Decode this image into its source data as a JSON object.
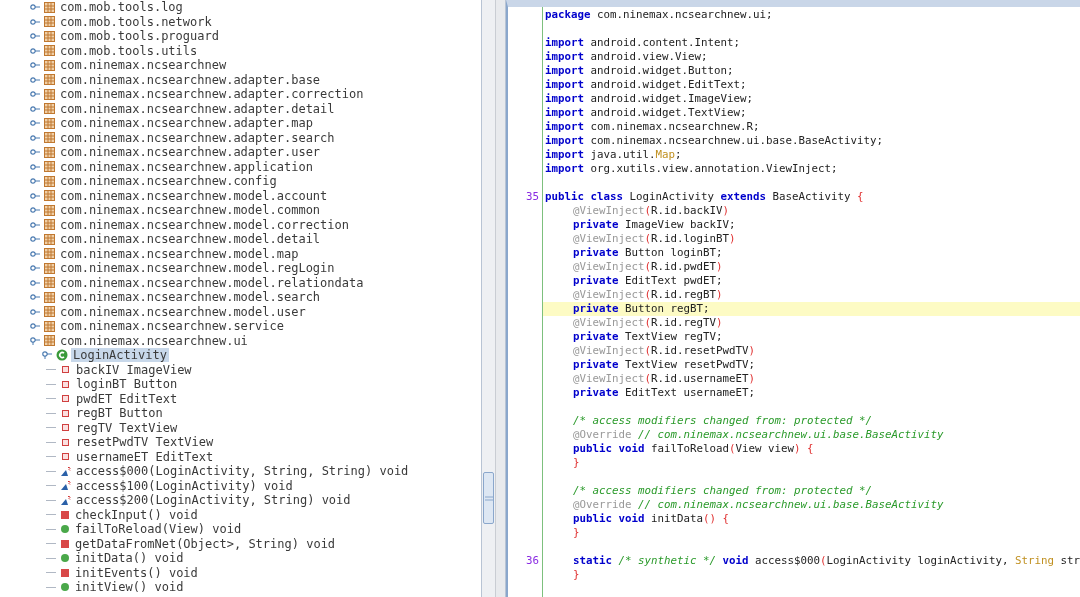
{
  "tree": {
    "packages": [
      {
        "label": "com.mob.tools.log",
        "expanded": false
      },
      {
        "label": "com.mob.tools.network",
        "expanded": false
      },
      {
        "label": "com.mob.tools.proguard",
        "expanded": false
      },
      {
        "label": "com.mob.tools.utils",
        "expanded": false
      },
      {
        "label": "com.ninemax.ncsearchnew",
        "expanded": false
      },
      {
        "label": "com.ninemax.ncsearchnew.adapter.base",
        "expanded": false
      },
      {
        "label": "com.ninemax.ncsearchnew.adapter.correction",
        "expanded": false
      },
      {
        "label": "com.ninemax.ncsearchnew.adapter.detail",
        "expanded": false
      },
      {
        "label": "com.ninemax.ncsearchnew.adapter.map",
        "expanded": false
      },
      {
        "label": "com.ninemax.ncsearchnew.adapter.search",
        "expanded": false
      },
      {
        "label": "com.ninemax.ncsearchnew.adapter.user",
        "expanded": false
      },
      {
        "label": "com.ninemax.ncsearchnew.application",
        "expanded": false
      },
      {
        "label": "com.ninemax.ncsearchnew.config",
        "expanded": false
      },
      {
        "label": "com.ninemax.ncsearchnew.model.account",
        "expanded": false
      },
      {
        "label": "com.ninemax.ncsearchnew.model.common",
        "expanded": false
      },
      {
        "label": "com.ninemax.ncsearchnew.model.correction",
        "expanded": false
      },
      {
        "label": "com.ninemax.ncsearchnew.model.detail",
        "expanded": false
      },
      {
        "label": "com.ninemax.ncsearchnew.model.map",
        "expanded": false
      },
      {
        "label": "com.ninemax.ncsearchnew.model.regLogin",
        "expanded": false
      },
      {
        "label": "com.ninemax.ncsearchnew.model.relationdata",
        "expanded": false
      },
      {
        "label": "com.ninemax.ncsearchnew.model.search",
        "expanded": false
      },
      {
        "label": "com.ninemax.ncsearchnew.model.user",
        "expanded": false
      },
      {
        "label": "com.ninemax.ncsearchnew.service",
        "expanded": false
      },
      {
        "label": "com.ninemax.ncsearchnew.ui",
        "expanded": true,
        "children": [
          {
            "label": "LoginActivity",
            "expanded": true,
            "selected": true,
            "children": [
              {
                "kind": "field",
                "label": "backIV ImageView",
                "selected": false
              },
              {
                "kind": "field",
                "label": "loginBT Button",
                "selected": false
              },
              {
                "kind": "field",
                "label": "pwdET EditText",
                "selected": false
              },
              {
                "kind": "field",
                "label": "regBT Button",
                "selected": false
              },
              {
                "kind": "field",
                "label": "regTV TextView",
                "selected": false
              },
              {
                "kind": "field",
                "label": "resetPwdTV TextView",
                "selected": false
              },
              {
                "kind": "field",
                "label": "usernameET EditText",
                "selected": false
              },
              {
                "kind": "static",
                "label": "access$000(LoginActivity, String, String) void",
                "selected": false
              },
              {
                "kind": "static",
                "label": "access$100(LoginActivity) void",
                "selected": false
              },
              {
                "kind": "static",
                "label": "access$200(LoginActivity, String) void",
                "selected": false
              },
              {
                "kind": "private",
                "label": "checkInput() void",
                "selected": false
              },
              {
                "kind": "public",
                "label": "failToReload(View) void",
                "selected": false
              },
              {
                "kind": "private",
                "label": "getDataFromNet(Object>, String) void",
                "selected": false
              },
              {
                "kind": "public",
                "label": "initData() void",
                "selected": false
              },
              {
                "kind": "private",
                "label": "initEvents() void",
                "selected": false
              },
              {
                "kind": "public",
                "label": "initView() void",
                "selected": false
              }
            ]
          }
        ]
      }
    ]
  },
  "editor": {
    "lines": [
      {
        "kind": "code",
        "highlighted": false,
        "indented": false,
        "tokens": [
          {
            "kind": "keyword",
            "text": "package"
          },
          {
            "kind": "plain",
            "text": " com.ninemax.ncsearchnew.ui;"
          }
        ]
      },
      {
        "kind": "blank",
        "highlighted": false
      },
      {
        "kind": "code",
        "highlighted": false,
        "indented": false,
        "tokens": [
          {
            "kind": "keyword",
            "text": "import"
          },
          {
            "kind": "plain",
            "text": " android.content.Intent;"
          }
        ]
      },
      {
        "kind": "code",
        "highlighted": false,
        "indented": false,
        "tokens": [
          {
            "kind": "keyword",
            "text": "import"
          },
          {
            "kind": "plain",
            "text": " android.view.View;"
          }
        ]
      },
      {
        "kind": "code",
        "highlighted": false,
        "indented": false,
        "tokens": [
          {
            "kind": "keyword",
            "text": "import"
          },
          {
            "kind": "plain",
            "text": " android.widget.Button;"
          }
        ]
      },
      {
        "kind": "code",
        "highlighted": false,
        "indented": false,
        "tokens": [
          {
            "kind": "keyword",
            "text": "import"
          },
          {
            "kind": "plain",
            "text": " android.widget.EditText;"
          }
        ]
      },
      {
        "kind": "code",
        "highlighted": false,
        "indented": false,
        "tokens": [
          {
            "kind": "keyword",
            "text": "import"
          },
          {
            "kind": "plain",
            "text": " android.widget.ImageView;"
          }
        ]
      },
      {
        "kind": "code",
        "highlighted": false,
        "indented": false,
        "tokens": [
          {
            "kind": "keyword",
            "text": "import"
          },
          {
            "kind": "plain",
            "text": " android.widget.TextView;"
          }
        ]
      },
      {
        "kind": "code",
        "highlighted": false,
        "indented": false,
        "tokens": [
          {
            "kind": "keyword",
            "text": "import"
          },
          {
            "kind": "plain",
            "text": " com.ninemax.ncsearchnew.R;"
          }
        ]
      },
      {
        "kind": "code",
        "highlighted": false,
        "indented": false,
        "tokens": [
          {
            "kind": "keyword",
            "text": "import"
          },
          {
            "kind": "plain",
            "text": " com.ninemax.ncsearchnew.ui.base.BaseActivity;"
          }
        ]
      },
      {
        "kind": "code",
        "highlighted": false,
        "indented": false,
        "tokens": [
          {
            "kind": "keyword",
            "text": "import"
          },
          {
            "kind": "plain",
            "text": " java.util."
          },
          {
            "kind": "type",
            "text": "Map"
          },
          {
            "kind": "plain",
            "text": ";"
          }
        ]
      },
      {
        "kind": "code",
        "highlighted": false,
        "indented": false,
        "tokens": [
          {
            "kind": "keyword",
            "text": "import"
          },
          {
            "kind": "plain",
            "text": " org.xutils.view.annotation.ViewInject;"
          }
        ]
      },
      {
        "kind": "blank",
        "highlighted": false
      },
      {
        "kind": "code",
        "highlighted": false,
        "indented": false,
        "number": "35",
        "tokens": [
          {
            "kind": "keyword",
            "text": "public"
          },
          {
            "kind": "keyword",
            "text": " class"
          },
          {
            "kind": "plain",
            "text": " LoginActivity"
          },
          {
            "kind": "keyword",
            "text": " extends"
          },
          {
            "kind": "plain",
            "text": " BaseActivity"
          },
          {
            "kind": "bracket",
            "text": " {"
          }
        ]
      },
      {
        "kind": "code",
        "highlighted": false,
        "indented": true,
        "tokens": [
          {
            "kind": "annotation",
            "text": "@ViewInject"
          },
          {
            "kind": "bracket",
            "text": "("
          },
          {
            "kind": "plain",
            "text": "R.id.backIV"
          },
          {
            "kind": "bracket",
            "text": ")"
          }
        ]
      },
      {
        "kind": "code",
        "highlighted": false,
        "indented": true,
        "tokens": [
          {
            "kind": "keyword",
            "text": "private"
          },
          {
            "kind": "plain",
            "text": " ImageView backIV;"
          }
        ]
      },
      {
        "kind": "code",
        "highlighted": false,
        "indented": true,
        "tokens": [
          {
            "kind": "annotation",
            "text": "@ViewInject"
          },
          {
            "kind": "bracket",
            "text": "("
          },
          {
            "kind": "plain",
            "text": "R.id.loginBT"
          },
          {
            "kind": "bracket",
            "text": ")"
          }
        ]
      },
      {
        "kind": "code",
        "highlighted": false,
        "indented": true,
        "tokens": [
          {
            "kind": "keyword",
            "text": "private"
          },
          {
            "kind": "plain",
            "text": " Button loginBT;"
          }
        ]
      },
      {
        "kind": "code",
        "highlighted": false,
        "indented": true,
        "tokens": [
          {
            "kind": "annotation",
            "text": "@ViewInject"
          },
          {
            "kind": "bracket",
            "text": "("
          },
          {
            "kind": "plain",
            "text": "R.id.pwdET"
          },
          {
            "kind": "bracket",
            "text": ")"
          }
        ]
      },
      {
        "kind": "code",
        "highlighted": false,
        "indented": true,
        "tokens": [
          {
            "kind": "keyword",
            "text": "private"
          },
          {
            "kind": "plain",
            "text": " EditText pwdET;"
          }
        ]
      },
      {
        "kind": "code",
        "highlighted": false,
        "indented": true,
        "tokens": [
          {
            "kind": "annotation",
            "text": "@ViewInject"
          },
          {
            "kind": "bracket",
            "text": "("
          },
          {
            "kind": "plain",
            "text": "R.id.regBT"
          },
          {
            "kind": "bracket",
            "text": ")"
          }
        ]
      },
      {
        "kind": "code",
        "highlighted": true,
        "indented": true,
        "tokens": [
          {
            "kind": "keyword",
            "text": "private"
          },
          {
            "kind": "plain",
            "text": " Button regBT;"
          }
        ]
      },
      {
        "kind": "code",
        "highlighted": false,
        "indented": true,
        "tokens": [
          {
            "kind": "annotation",
            "text": "@ViewInject"
          },
          {
            "kind": "bracket",
            "text": "("
          },
          {
            "kind": "plain",
            "text": "R.id.regTV"
          },
          {
            "kind": "bracket",
            "text": ")"
          }
        ]
      },
      {
        "kind": "code",
        "highlighted": false,
        "indented": true,
        "tokens": [
          {
            "kind": "keyword",
            "text": "private"
          },
          {
            "kind": "plain",
            "text": " TextView regTV;"
          }
        ]
      },
      {
        "kind": "code",
        "highlighted": false,
        "indented": true,
        "tokens": [
          {
            "kind": "annotation",
            "text": "@ViewInject"
          },
          {
            "kind": "bracket",
            "text": "("
          },
          {
            "kind": "plain",
            "text": "R.id.resetPwdTV"
          },
          {
            "kind": "bracket",
            "text": ")"
          }
        ]
      },
      {
        "kind": "code",
        "highlighted": false,
        "indented": true,
        "tokens": [
          {
            "kind": "keyword",
            "text": "private"
          },
          {
            "kind": "plain",
            "text": " TextView resetPwdTV;"
          }
        ]
      },
      {
        "kind": "code",
        "highlighted": false,
        "indented": true,
        "tokens": [
          {
            "kind": "annotation",
            "text": "@ViewInject"
          },
          {
            "kind": "bracket",
            "text": "("
          },
          {
            "kind": "plain",
            "text": "R.id.usernameET"
          },
          {
            "kind": "bracket",
            "text": ")"
          }
        ]
      },
      {
        "kind": "code",
        "highlighted": false,
        "indented": true,
        "tokens": [
          {
            "kind": "keyword",
            "text": "private"
          },
          {
            "kind": "plain",
            "text": " EditText usernameET;"
          }
        ]
      },
      {
        "kind": "blank",
        "highlighted": false
      },
      {
        "kind": "code",
        "highlighted": false,
        "indented": true,
        "tokens": [
          {
            "kind": "comment",
            "text": "/* access modifiers changed from: protected */"
          }
        ]
      },
      {
        "kind": "code",
        "highlighted": false,
        "indented": true,
        "tokens": [
          {
            "kind": "annotation",
            "text": "@Override"
          },
          {
            "kind": "comment",
            "text": " // com.ninemax.ncsearchnew.ui.base.BaseActivity"
          }
        ]
      },
      {
        "kind": "code",
        "highlighted": false,
        "indented": true,
        "tokens": [
          {
            "kind": "keyword",
            "text": "public"
          },
          {
            "kind": "keyword",
            "text": " void"
          },
          {
            "kind": "plain",
            "text": " failToReload"
          },
          {
            "kind": "bracket",
            "text": "("
          },
          {
            "kind": "plain",
            "text": "View view"
          },
          {
            "kind": "bracket",
            "text": ") {"
          }
        ]
      },
      {
        "kind": "code",
        "highlighted": false,
        "indented": true,
        "tokens": [
          {
            "kind": "bracket",
            "text": "}"
          }
        ]
      },
      {
        "kind": "blank",
        "highlighted": false
      },
      {
        "kind": "code",
        "highlighted": false,
        "indented": true,
        "tokens": [
          {
            "kind": "comment",
            "text": "/* access modifiers changed from: protected */"
          }
        ]
      },
      {
        "kind": "code",
        "highlighted": false,
        "indented": true,
        "tokens": [
          {
            "kind": "annotation",
            "text": "@Override"
          },
          {
            "kind": "comment",
            "text": " // com.ninemax.ncsearchnew.ui.base.BaseActivity"
          }
        ]
      },
      {
        "kind": "code",
        "highlighted": false,
        "indented": true,
        "tokens": [
          {
            "kind": "keyword",
            "text": "public"
          },
          {
            "kind": "keyword",
            "text": " void"
          },
          {
            "kind": "plain",
            "text": " initData"
          },
          {
            "kind": "bracket",
            "text": "() {"
          }
        ]
      },
      {
        "kind": "code",
        "highlighted": false,
        "indented": true,
        "tokens": [
          {
            "kind": "bracket",
            "text": "}"
          }
        ]
      },
      {
        "kind": "blank",
        "highlighted": false
      },
      {
        "kind": "code",
        "highlighted": false,
        "indented": true,
        "number": "36",
        "tokens": [
          {
            "kind": "keyword",
            "text": "static"
          },
          {
            "kind": "comment",
            "text": " /* synthetic */"
          },
          {
            "kind": "keyword",
            "text": " void"
          },
          {
            "kind": "plain",
            "text": " access$000"
          },
          {
            "kind": "bracket",
            "text": "("
          },
          {
            "kind": "plain",
            "text": "LoginActivity loginActivity, "
          },
          {
            "kind": "type",
            "text": "String"
          },
          {
            "kind": "plain",
            "text": " str"
          }
        ]
      },
      {
        "kind": "code",
        "highlighted": false,
        "indented": true,
        "tokens": [
          {
            "kind": "bracket",
            "text": "}"
          }
        ]
      }
    ]
  }
}
